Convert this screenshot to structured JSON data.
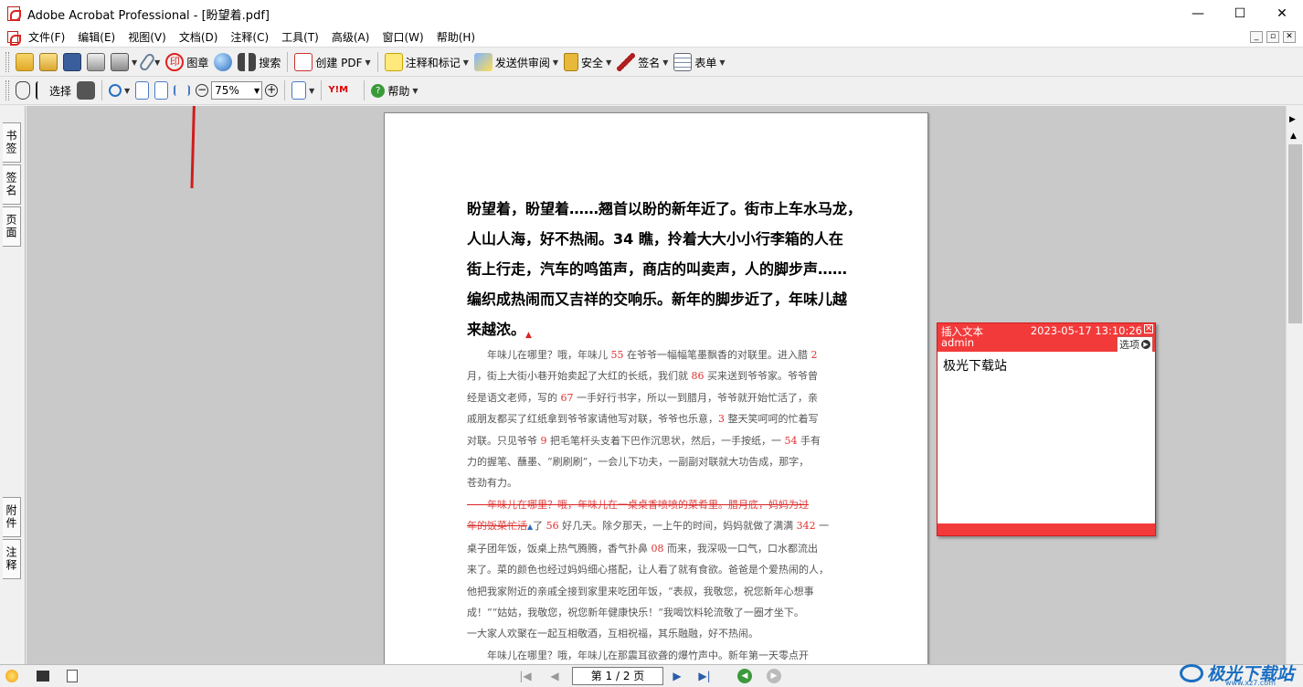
{
  "titlebar": {
    "title": "Adobe Acrobat Professional - [盼望着.pdf]",
    "minimize": "—",
    "maximize": "☐",
    "close": "✕"
  },
  "menu": [
    "文件(F)",
    "编辑(E)",
    "视图(V)",
    "文档(D)",
    "注释(C)",
    "工具(T)",
    "高级(A)",
    "窗口(W)",
    "帮助(H)"
  ],
  "toolbar1": {
    "stamp": "图章",
    "search": "搜索",
    "create_pdf": "创建 PDF",
    "comment_markup": "注释和标记",
    "send_review": "发送供审阅",
    "security": "安全",
    "sign": "签名",
    "forms": "表单"
  },
  "toolbar2": {
    "select": "选择",
    "zoom": "75%",
    "help": "帮助"
  },
  "left_tabs": [
    "书签",
    "签名",
    "页面",
    "附件",
    "注释"
  ],
  "document": {
    "bold_lines": [
      "盼望着，盼望着……翘首以盼的新年近了。街市上车水马龙，",
      "人山人海，好不热闹。34 瞧，拎着大大小小行李箱的人在",
      "街上行走，汽车的鸣笛声，商店的叫卖声，人的脚步声……",
      "编织成热闹而又吉祥的交响乐。新年的脚步近了，年味儿越",
      "来越浓。"
    ],
    "p1": [
      {
        "t": "　　年味儿在哪里？哦，年味儿 ",
        "n": "55",
        "a": " 在爷爷一幅幅笔墨飘香的对联里。进入腊 ",
        "n2": "2"
      },
      {
        "t": "月，街上大街小巷开始卖起了大红的长纸，我们就 ",
        "n": "86",
        "a": " 买来送到爷爷家。爷爷曾"
      },
      {
        "t": "经是语文老师，写的 ",
        "n": "67",
        "a": " 一手好行书字，所以一到腊月，爷爷就开始忙活了，亲"
      },
      {
        "t": "戚朋友都买了红纸拿到爷爷家请他写对联，爷爷也乐意，",
        "n": "3",
        "a": " 整天笑呵呵的忙着写"
      },
      {
        "t": "对联。只见爷爷 ",
        "n": "9",
        "a": " 把毛笔杆头支着下巴作沉思状，然后，一手按纸，一 ",
        "n2": "54",
        "a2": " 手有"
      },
      {
        "t": "力的握笔、蘸墨、“刷刷刷”，一会儿下功夫，一副副对联就大功告成，那字，"
      },
      {
        "t": "苍劲有力。"
      }
    ],
    "strike1": "　　年味儿在哪里？哦，年味儿在一桌桌香喷喷的菜肴里。腊月底，妈妈为过",
    "strike2": "年的饭菜忙活",
    "p2": [
      {
        "t": "了 ",
        "n": "56",
        "a": " 好几天。除夕那天，一上午的时间，妈妈就做了满满 ",
        "n2": "342",
        "a2": " 一"
      },
      {
        "t": "桌子团年饭，饭桌上热气腾腾，香气扑鼻 ",
        "n": "08",
        "a": " 而来，我深吸一口气，口水都流出"
      },
      {
        "t": "来了。菜的颜色也经过妈妈细心搭配，让人看了就有食欲。爸爸是个爱热闹的人，"
      },
      {
        "t": "他把我家附近的亲戚全接到家里来吃团年饭，“表叔，我敬您，祝您新年心想事"
      },
      {
        "t": "成！”“姑姑，我敬您，祝您新年健康快乐！”我喝饮料轮流敬了一圈才坐下。"
      },
      {
        "t": "一大家人欢聚在一起互相敬酒，互相祝福，其乐融融，好不热闹。"
      },
      {
        "t": "　　年味儿在哪里？哦，年味儿在那震耳欲聋的爆竹声中。新年第一天零点开"
      }
    ]
  },
  "note": {
    "type": "插入文本",
    "timestamp": "2023-05-17 13:10:26",
    "author": "admin",
    "options": "选项",
    "content": "极光下载站"
  },
  "status": {
    "page": "第 1 / 2 页"
  },
  "watermark": {
    "text": "极光下载站",
    "sub": "www.xz7.com"
  },
  "colors": {
    "note_red": "#f33a3a",
    "arrow_red": "#d01c1c",
    "number_red": "#e03030"
  }
}
